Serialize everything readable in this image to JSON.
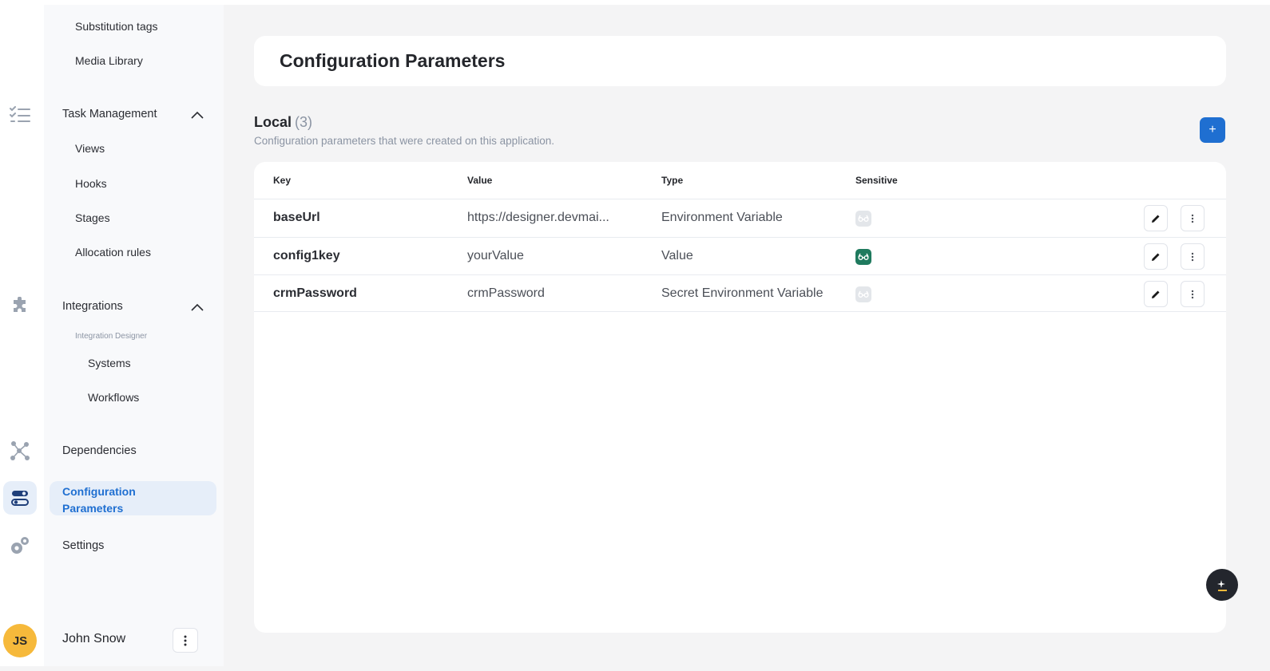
{
  "nav": {
    "items": [
      {
        "label": "Substitution tags"
      },
      {
        "label": "Media Library"
      },
      {
        "label": "Task Management"
      },
      {
        "label": "Views"
      },
      {
        "label": "Hooks"
      },
      {
        "label": "Stages"
      },
      {
        "label": "Allocation rules"
      },
      {
        "label": "Integrations"
      },
      {
        "label": "Integration Designer"
      },
      {
        "label": "Systems"
      },
      {
        "label": "Workflows"
      },
      {
        "label": "Dependencies"
      },
      {
        "label": "Configuration Parameters"
      },
      {
        "label": "Settings"
      }
    ]
  },
  "rail": {
    "icons": [
      "task-list-icon",
      "puzzle-icon",
      "network-icon",
      "toggles-icon",
      "gears-icon"
    ]
  },
  "user": {
    "initials": "JS",
    "name": "John Snow"
  },
  "header": {
    "title": "Configuration Parameters"
  },
  "section": {
    "title": "Local",
    "count": "(3)",
    "description": "Configuration parameters that were created on this application.",
    "add_label": "+"
  },
  "table": {
    "columns": [
      "Key",
      "Value",
      "Type",
      "Sensitive"
    ],
    "rows": [
      {
        "key": "baseUrl",
        "value": "https://designer.devmai...",
        "type": "Environment Variable",
        "sensitive": false
      },
      {
        "key": "config1key",
        "value": "yourValue",
        "type": "Value",
        "sensitive": true
      },
      {
        "key": "crmPassword",
        "value": "crmPassword",
        "type": "Secret Environment Variable",
        "sensitive": false
      }
    ]
  },
  "colors": {
    "accent": "#1f6fd1",
    "sensitive_on": "#1f7a5e",
    "avatar": "#f6b93b"
  }
}
